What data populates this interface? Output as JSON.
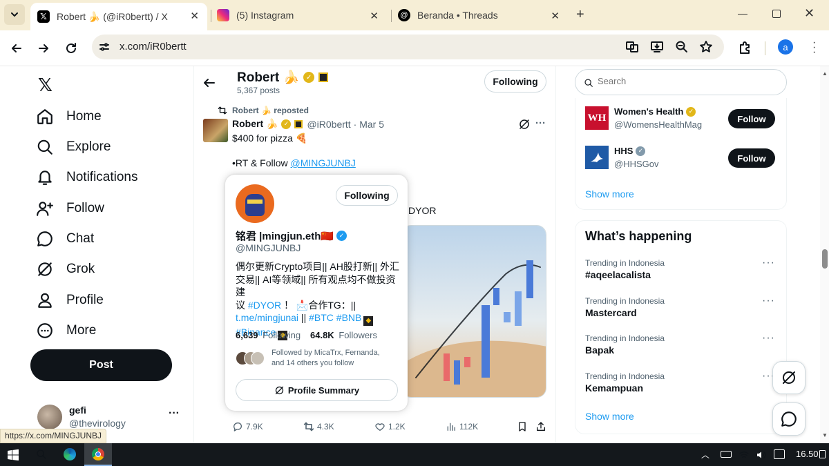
{
  "browser": {
    "tabs": [
      {
        "title": "Robert 🍌 (@iR0bertt) / X",
        "icon": "x-logo-icon"
      },
      {
        "title": "(5) Instagram",
        "icon": "instagram-icon"
      },
      {
        "title": "Beranda • Threads",
        "icon": "threads-icon"
      }
    ],
    "url": "x.com/iR0bertt",
    "profile_initial": "a",
    "status_url": "https://x.com/MINGJUNBJ"
  },
  "nav": {
    "items": [
      "Home",
      "Explore",
      "Notifications",
      "Follow",
      "Chat",
      "Grok",
      "Profile",
      "More"
    ],
    "post_label": "Post",
    "account": {
      "name": "gefi",
      "handle": "@thevirology"
    }
  },
  "header": {
    "name": "Robert 🍌",
    "posts": "5,367 posts",
    "following_label": "Following"
  },
  "tweet": {
    "repost_label": "Robert 🍌 reposted",
    "author": "Robert 🍌",
    "handle": "@iR0bertt",
    "date": "· Mar 5",
    "line1": "$400 for pizza 🍕",
    "line2_prefix": "•RT & Follow ",
    "line2_link": "@MINGJUNBJ",
    "dyor_fragment": "DYOR",
    "stats": {
      "replies": "7.9K",
      "reposts": "4.3K",
      "likes": "1.2K",
      "views": "112K"
    }
  },
  "hovercard": {
    "following_label": "Following",
    "name": "铭君 |mingjun.eth🇨🇳",
    "handle": "@MINGJUNBJ",
    "bio_line1": "偶尔更新Crypto项目|| AH股打新|| 外汇",
    "bio_line2": "交易|| AI等领域|| 所有观点均不做投资建",
    "bio_line3_pre": "议 ",
    "bio_line3_tag": "#DYOR",
    "bio_line3_post": " ！ 📩合作TG：||",
    "bio_line4_link": "t.me/mingjunai",
    "bio_line4_sep": " || ",
    "bio_line4_tags": "#BTC #BNB",
    "bio_line5_tag": "#Binance",
    "following_count": "6,639",
    "following_text": "Following",
    "followers_count": "64.8K",
    "followers_text": "Followers",
    "followed_by_1": "Followed by MicaTrx, Fernanda,",
    "followed_by_2": "and 14 others you follow",
    "summary_label": "Profile Summary"
  },
  "sidebar": {
    "search_placeholder": "Search",
    "who": [
      {
        "name": "Women's Health",
        "handle": "@WomensHealthMag",
        "btn": "Follow",
        "avatar": "WH"
      },
      {
        "name": "HHS",
        "handle": "@HHSGov",
        "btn": "Follow"
      }
    ],
    "show_more": "Show more",
    "happening_title": "What’s happening",
    "trends": [
      {
        "category": "Trending in Indonesia",
        "name": "#aqeelacalista"
      },
      {
        "category": "Trending in Indonesia",
        "name": "Mastercard"
      },
      {
        "category": "Trending in Indonesia",
        "name": "Bapak"
      },
      {
        "category": "Trending in Indonesia",
        "name": "Kemampuan"
      }
    ],
    "show_more_2": "Show more"
  },
  "taskbar": {
    "time": "16.50"
  },
  "colors": {
    "accent": "#1d9bf0",
    "tab_strip": "#f6eed6",
    "gold": "#e2b719",
    "dark": "#0f1419"
  }
}
